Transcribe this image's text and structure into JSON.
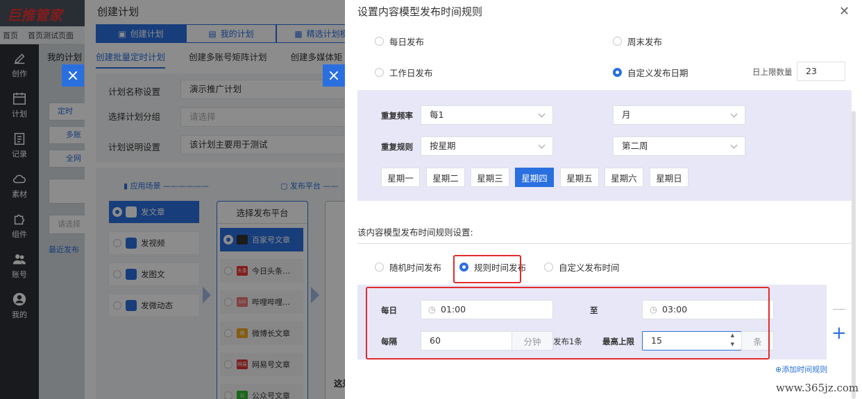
{
  "app": {
    "logo": "巨推管家"
  },
  "top_tabs": [
    "首页",
    "首页测试页面"
  ],
  "nav": [
    {
      "label": "创作",
      "icon": "pen-icon"
    },
    {
      "label": "计划",
      "icon": "calendar-icon"
    },
    {
      "label": "记录",
      "icon": "clipboard-icon"
    },
    {
      "label": "素材",
      "icon": "cloud-icon"
    },
    {
      "label": "组件",
      "icon": "puzzle-icon"
    },
    {
      "label": "账号",
      "icon": "people-icon"
    },
    {
      "label": "我的",
      "icon": "user-icon"
    }
  ],
  "subpanel": {
    "title": "我的计划",
    "items": [
      "定时",
      "多账",
      "全网"
    ],
    "search_placeholder": "请选择",
    "recent": "最近发布"
  },
  "mid": {
    "title": "创建计划",
    "tabs": [
      "创建计划",
      "我的计划",
      "精选计划模"
    ],
    "subtabs": [
      "创建批量定时计划",
      "创建多账号矩阵计划",
      "创建多媒体矩"
    ],
    "form": [
      {
        "label": "计划名称设置",
        "value": "演示推广计划",
        "placeholder": ""
      },
      {
        "label": "选择计划分组",
        "value": "",
        "placeholder": "请选择"
      },
      {
        "label": "计划说明设置",
        "value": "该计划主要用于测试",
        "placeholder": ""
      }
    ],
    "flow_headers": [
      "应用场景",
      "发布平台"
    ],
    "scenes": [
      "发文章",
      "发视频",
      "发图文",
      "发微动态"
    ],
    "platform_title": "选择发布平台",
    "platforms": [
      {
        "name": "百家号文章",
        "badge": "",
        "color": "#333"
      },
      {
        "name": "今日头条…",
        "badge": "头条",
        "color": "#e33"
      },
      {
        "name": "哔哩哔哩…",
        "badge": "bili",
        "color": "#e77"
      },
      {
        "name": "微博长文章",
        "badge": "微",
        "color": "#f5a623"
      },
      {
        "name": "网易号文章",
        "badge": "网易",
        "color": "#d33"
      },
      {
        "name": "公众号文章",
        "badge": "公",
        "color": "#3b3"
      }
    ],
    "bottom_text": "这是"
  },
  "panel": {
    "title": "设置内容模型发布时间规则",
    "freq_options": [
      {
        "label": "每日发布",
        "selected": false
      },
      {
        "label": "周末发布",
        "selected": false
      },
      {
        "label": "工作日发布",
        "selected": false
      },
      {
        "label": "自定义发布日期",
        "selected": true
      }
    ],
    "daily_limit_label": "日上限数量",
    "daily_limit_value": "23",
    "repeat": {
      "freq_label": "重复频率",
      "freq_value": "每1",
      "freq_unit": "月",
      "rule_label": "重复规则",
      "rule_value": "按星期",
      "rule_week": "第二周",
      "weekdays": [
        "星期一",
        "星期二",
        "星期三",
        "星期四",
        "星期五",
        "星期六",
        "星期日"
      ],
      "weekday_selected": "星期四"
    },
    "time_rule_label": "该内容模型发布时间规则设置:",
    "time_options": [
      {
        "label": "随机时间发布",
        "selected": false
      },
      {
        "label": "规则时间发布",
        "selected": true
      },
      {
        "label": "自定义发布时间",
        "selected": false
      }
    ],
    "time": {
      "daily_label": "每日",
      "start": "01:00",
      "to_label": "至",
      "end": "03:00",
      "interval_label": "每隔",
      "interval_value": "60",
      "interval_unit": "分钟",
      "post_label": "发布1条",
      "max_label": "最高上限",
      "max_value": "15",
      "max_unit": "条"
    },
    "add_rule": "⊕添加时间规则"
  },
  "watermark": "www.365jz.com",
  "colors": {
    "accent": "#2a6fe0",
    "highlight": "#e02b2b",
    "lavender": "#e7e7f7"
  }
}
